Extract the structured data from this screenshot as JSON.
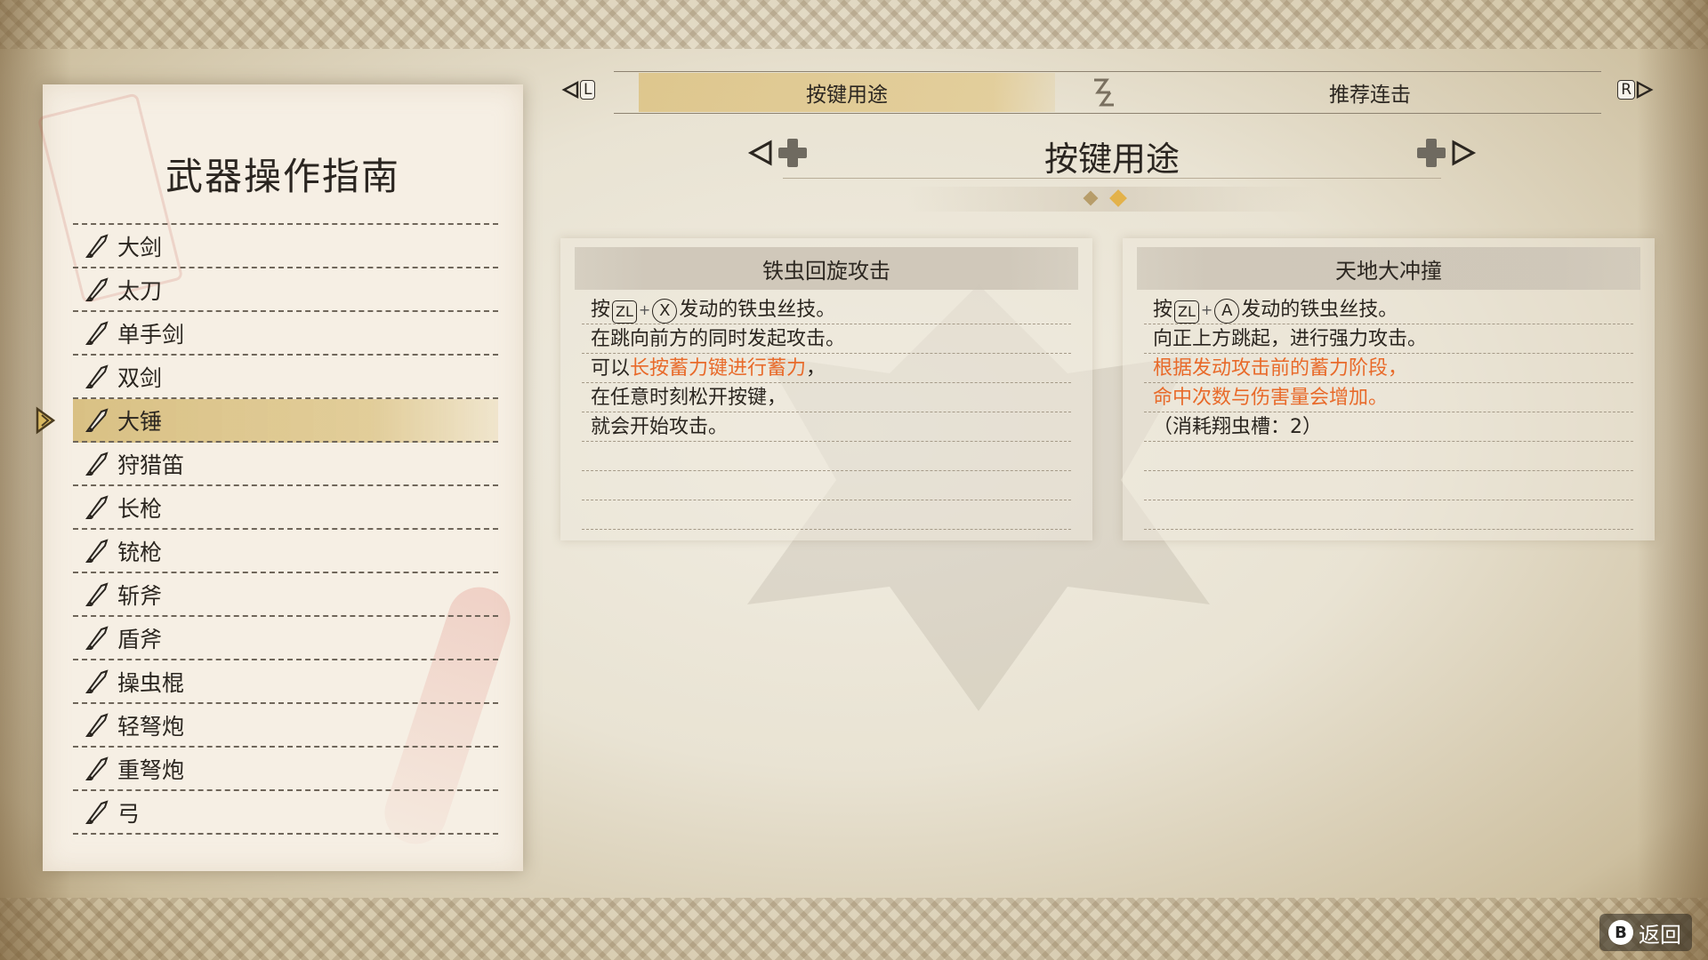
{
  "panel": {
    "title": "武器操作指南",
    "selected_index": 4,
    "weapons": [
      {
        "label": "大剑",
        "icon": "great-sword-icon"
      },
      {
        "label": "太刀",
        "icon": "long-sword-icon"
      },
      {
        "label": "单手剑",
        "icon": "sword-and-shield-icon"
      },
      {
        "label": "双剑",
        "icon": "dual-blades-icon"
      },
      {
        "label": "大锤",
        "icon": "hammer-icon"
      },
      {
        "label": "狩猎笛",
        "icon": "hunting-horn-icon"
      },
      {
        "label": "长枪",
        "icon": "lance-icon"
      },
      {
        "label": "铳枪",
        "icon": "gunlance-icon"
      },
      {
        "label": "斩斧",
        "icon": "switch-axe-icon"
      },
      {
        "label": "盾斧",
        "icon": "charge-blade-icon"
      },
      {
        "label": "操虫棍",
        "icon": "insect-glaive-icon"
      },
      {
        "label": "轻弩炮",
        "icon": "light-bowgun-icon"
      },
      {
        "label": "重弩炮",
        "icon": "heavy-bowgun-icon"
      },
      {
        "label": "弓",
        "icon": "bow-icon"
      }
    ]
  },
  "tabs": {
    "left_key": "L",
    "right_key": "R",
    "items": [
      {
        "label": "按键用途",
        "active": true
      },
      {
        "label": "推荐连击",
        "active": false
      }
    ]
  },
  "section": {
    "title": "按键用途",
    "page_count": 2,
    "current_page": 2
  },
  "cards": [
    {
      "title": "铁虫回旋攻击",
      "lines": [
        {
          "prefix": "按",
          "buttons": [
            "ZL",
            "X"
          ],
          "suffix": "发动的铁虫丝技。"
        },
        {
          "text": "在跳向前方的同时发起攻击。"
        },
        {
          "text": "可以",
          "highlight": "长按蓄力键进行蓄力",
          "tail": "，"
        },
        {
          "text": "在任意时刻松开按键，"
        },
        {
          "text": "就会开始攻击。"
        },
        {
          "text": ""
        },
        {
          "text": ""
        },
        {
          "text": ""
        }
      ]
    },
    {
      "title": "天地大冲撞",
      "lines": [
        {
          "prefix": "按",
          "buttons": [
            "ZL",
            "A"
          ],
          "suffix": "发动的铁虫丝技。"
        },
        {
          "text": "向正上方跳起，进行强力攻击。"
        },
        {
          "highlight": "根据发动攻击前的蓄力阶段，"
        },
        {
          "highlight": "命中次数与伤害量会增加。"
        },
        {
          "text": "（消耗翔虫槽：2）"
        },
        {
          "text": ""
        },
        {
          "text": ""
        },
        {
          "text": ""
        }
      ]
    }
  ],
  "back": {
    "button": "B",
    "label": "返回"
  },
  "colors": {
    "accent_gold": "#d9bf82",
    "highlight_orange": "#e86a2a",
    "paper": "#f6efe4"
  }
}
